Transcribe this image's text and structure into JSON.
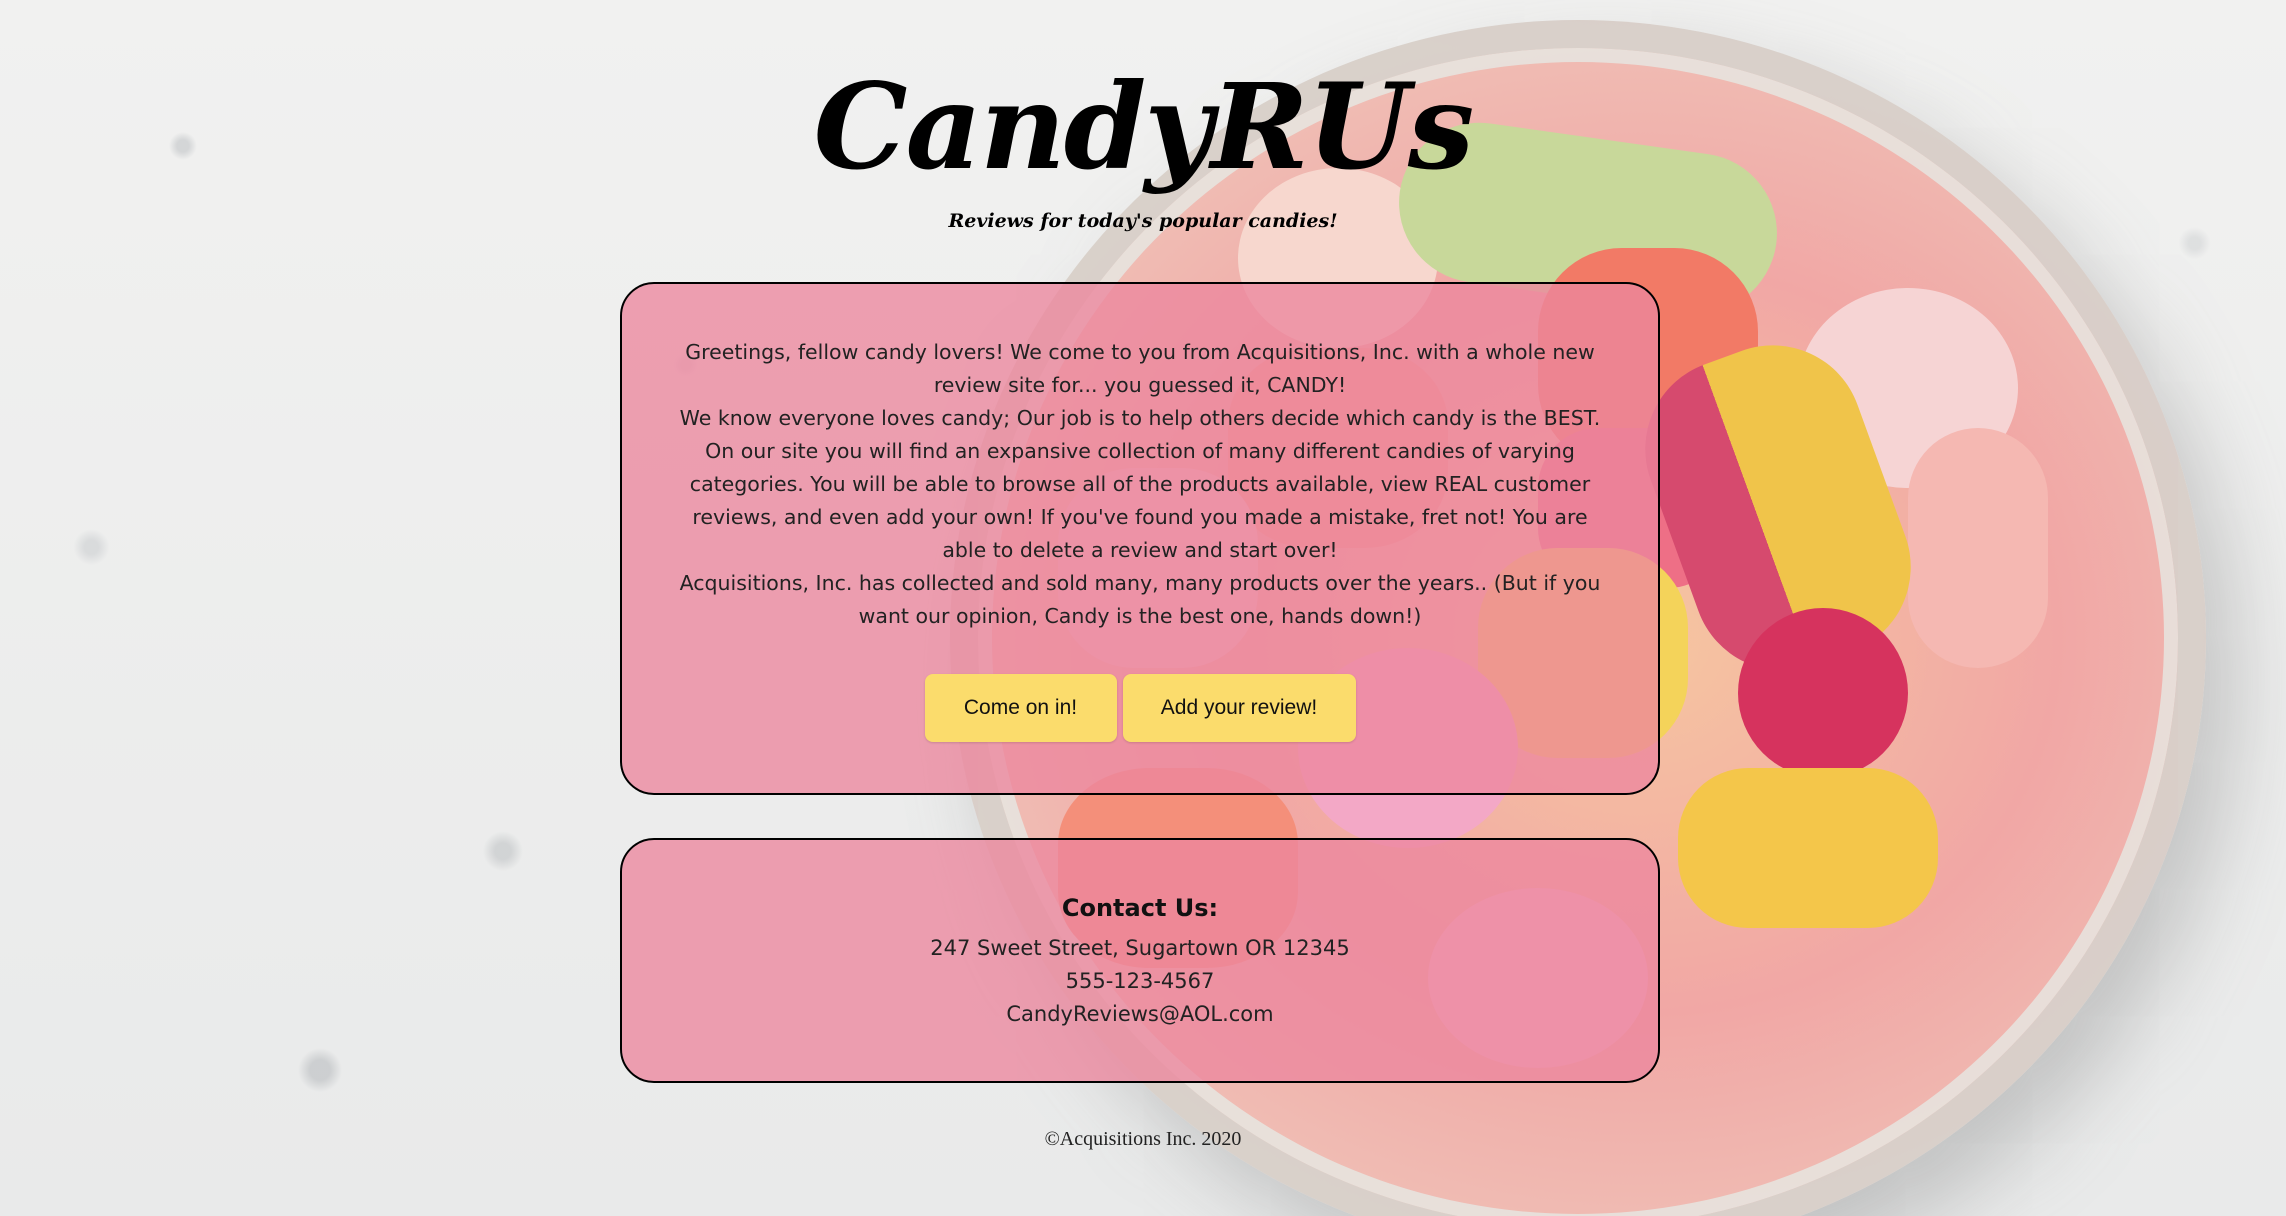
{
  "header": {
    "title": "CandyRUs",
    "subtitle": "Reviews for today's popular candies!"
  },
  "intro": {
    "paragraphs": [
      "Greetings, fellow candy lovers! We come to you from Acquisitions, Inc. with a whole new review site for... you guessed it, CANDY!",
      "We know everyone loves candy; Our job is to help others decide which candy is the BEST. On our site you will find an expansive collection of many different candies of varying categories. You will be able to browse all of the products available, view REAL customer reviews, and even add your own! If you've found you made a mistake, fret not! You are able to delete a review and start over!",
      "Acquisitions, Inc. has collected and sold many, many products over the years.. (But if you want our opinion, Candy is the best one, hands down!)"
    ],
    "buttons": {
      "enter_label": "Come on in!",
      "review_label": "Add your review!"
    }
  },
  "contact": {
    "heading": "Contact Us:",
    "address": "247 Sweet Street, Sugartown OR 12345",
    "phone": "555-123-4567",
    "email": "CandyReviews@AOL.com"
  },
  "footer": {
    "copyright": "©Acquisitions Inc. 2020"
  },
  "colors": {
    "card_background": "#ec869e",
    "button_background": "#fbdc6c",
    "border": "#000000"
  }
}
